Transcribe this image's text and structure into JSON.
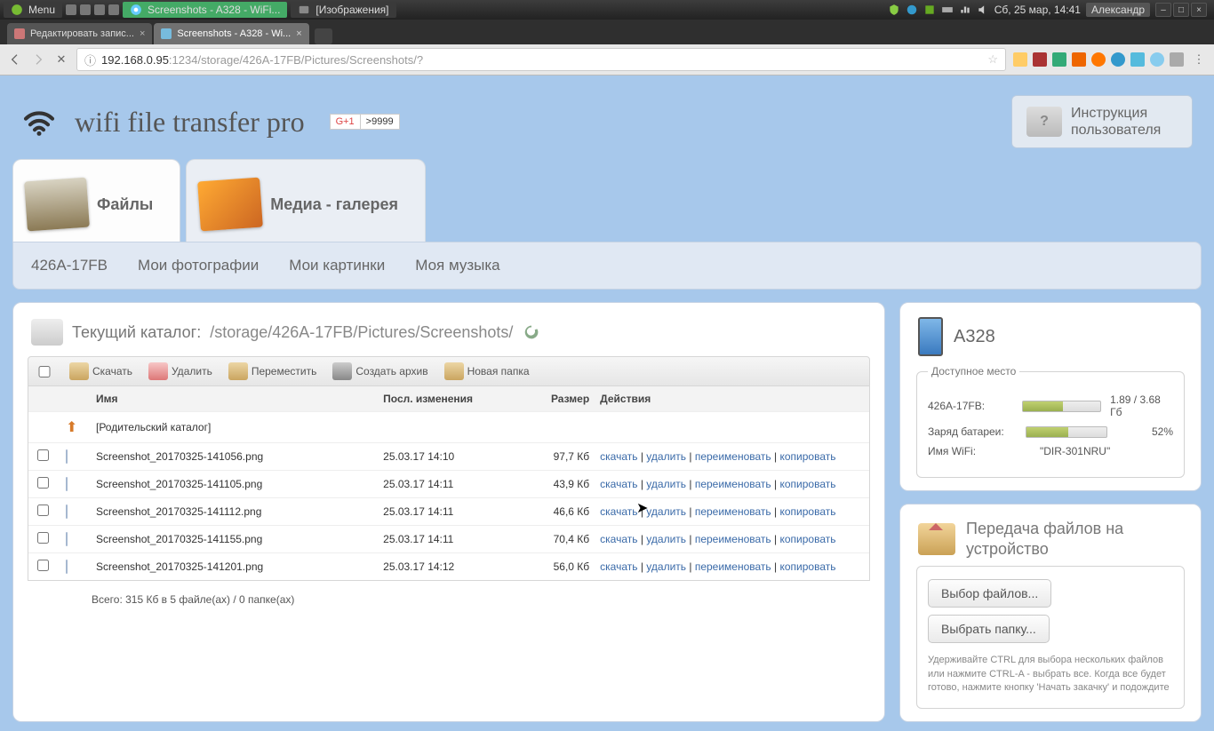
{
  "sysbar": {
    "menu": "Menu",
    "tasks": [
      "Screenshots - A328 - WiFi...",
      "[Изображения]"
    ],
    "clock": "Сб, 25 мар, 14:41",
    "user": "Александр"
  },
  "browser": {
    "tabs": [
      {
        "label": "Редактировать запис...",
        "active": false
      },
      {
        "label": "Screenshots - A328 - Wi...",
        "active": true
      }
    ],
    "url_host": "192.168.0.95",
    "url_path": ":1234/storage/426A-17FB/Pictures/Screenshots/?"
  },
  "app": {
    "title": "wifi file transfer pro",
    "gplus_label": "G+1",
    "gplus_count": ">9999",
    "help": "Инструкция пользователя",
    "tabs": {
      "files": "Файлы",
      "media": "Медиа - галерея"
    },
    "subnav": [
      "426A-17FB",
      "Мои фотографии",
      "Мои картинки",
      "Моя музыка"
    ]
  },
  "breadcrumb": {
    "label": "Текущий каталог:",
    "path": "/storage/426A-17FB/Pictures/Screenshots/"
  },
  "toolbar": {
    "download": "Скачать",
    "delete": "Удалить",
    "move": "Переместить",
    "archive": "Создать архив",
    "newfolder": "Новая папка"
  },
  "columns": {
    "name": "Имя",
    "modified": "Посл. изменения",
    "size": "Размер",
    "actions": "Действия"
  },
  "parent": "[Родительский каталог]",
  "actions": {
    "download": "скачать",
    "delete": "удалить",
    "rename": "переименовать",
    "copy": "копировать",
    "sep": " | "
  },
  "files": [
    {
      "name": "Screenshot_20170325-141056.png",
      "date": "25.03.17 14:10",
      "size": "97,7 Кб"
    },
    {
      "name": "Screenshot_20170325-141105.png",
      "date": "25.03.17 14:11",
      "size": "43,9 Кб"
    },
    {
      "name": "Screenshot_20170325-141112.png",
      "date": "25.03.17 14:11",
      "size": "46,6 Кб"
    },
    {
      "name": "Screenshot_20170325-141155.png",
      "date": "25.03.17 14:11",
      "size": "70,4 Кб"
    },
    {
      "name": "Screenshot_20170325-141201.png",
      "date": "25.03.17 14:12",
      "size": "56,0 Кб"
    }
  ],
  "summary": "Всего: 315 Кб в 5 файле(ах) / 0 папке(ах)",
  "device": {
    "name": "A328",
    "storage_legend": "Доступное место",
    "storage_label": "426A-17FB:",
    "storage_value": "1.89 / 3.68 Гб",
    "storage_pct": 51,
    "battery_label": "Заряд батареи:",
    "battery_value": "52%",
    "battery_pct": 52,
    "wifi_label": "Имя WiFi:",
    "wifi_value": "\"DIR-301NRU\""
  },
  "upload": {
    "title": "Передача файлов на устройство",
    "choose_files": "Выбор файлов...",
    "choose_folder": "Выбрать папку...",
    "hint": "Удерживайте CTRL для выбора нескольких файлов или нажмите CTRL-A - выбрать все. Когда все будет готово, нажмите кнопку 'Начать закачку' и подождите"
  }
}
